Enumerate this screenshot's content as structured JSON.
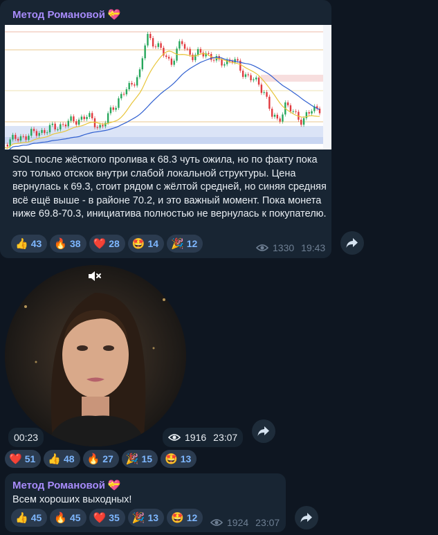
{
  "post1": {
    "sender": "Метод Романовой",
    "sender_emoji": "💝",
    "text": "SOL после жёсткого пролива к 68.3 чуть ожила, но по факту пока это только отскок внутри слабой локальной структуры. Цена вернулась к 69.3, стоит рядом с жёлтой средней, но синяя средняя всё ещё выше - в районе 70.2, и это важный момент. Пока монета ниже 69.8-70.3, инициатива полностью не вернулась к покупателю.",
    "reactions": [
      {
        "emoji": "👍",
        "count": "43"
      },
      {
        "emoji": "🔥",
        "count": "38"
      },
      {
        "emoji": "❤️",
        "count": "28"
      },
      {
        "emoji": "🤩",
        "count": "14"
      },
      {
        "emoji": "🎉",
        "count": "12"
      }
    ],
    "views": "1330",
    "time": "19:43"
  },
  "video_post": {
    "muted_icon": "speaker-muted-icon",
    "duration": "00:23",
    "views": "1916",
    "time": "23:07",
    "reactions": [
      {
        "emoji": "❤️",
        "count": "51"
      },
      {
        "emoji": "👍",
        "count": "48"
      },
      {
        "emoji": "🔥",
        "count": "27"
      },
      {
        "emoji": "🎉",
        "count": "15"
      },
      {
        "emoji": "🤩",
        "count": "13"
      }
    ]
  },
  "post3": {
    "sender": "Метод Романовой",
    "sender_emoji": "💝",
    "text": "Всем хороших выходных!",
    "reactions": [
      {
        "emoji": "👍",
        "count": "45"
      },
      {
        "emoji": "🔥",
        "count": "45"
      },
      {
        "emoji": "❤️",
        "count": "35"
      },
      {
        "emoji": "🎉",
        "count": "13"
      },
      {
        "emoji": "🤩",
        "count": "12"
      }
    ],
    "views": "1924",
    "time": "23:07"
  },
  "icons": {
    "views": "eye-icon",
    "forward": "forward-arrow-icon"
  },
  "colors": {
    "background": "#0e1621",
    "bubble": "#182533",
    "sender": "#a78bfa",
    "reaction_count": "#7eb7ff",
    "meta": "#6e7f93"
  }
}
